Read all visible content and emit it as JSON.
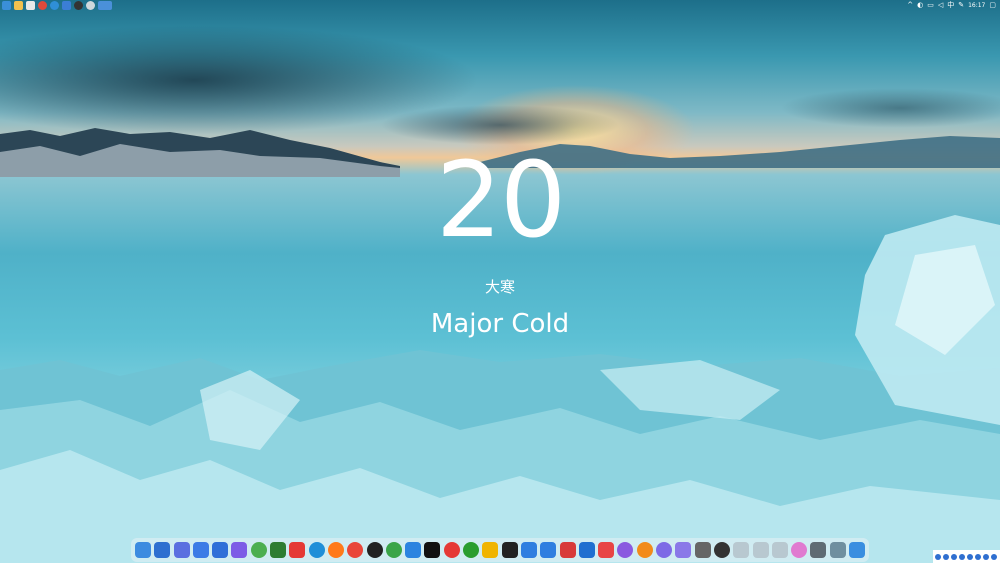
{
  "wallpaper": {
    "day_number": "20",
    "solar_term_cn": "大寒",
    "solar_term_en": "Major Cold"
  },
  "topbar": {
    "left_icons": [
      {
        "name": "windows-start-icon",
        "color": "#3a8fd8"
      },
      {
        "name": "folder-icon",
        "color": "#f2c14e"
      },
      {
        "name": "file-icon",
        "color": "#e8e8e8"
      },
      {
        "name": "chrome-icon",
        "color": "#e04a3a"
      },
      {
        "name": "edge-icon",
        "color": "#2f8fd6"
      },
      {
        "name": "mail-icon",
        "color": "#3b7ed6"
      },
      {
        "name": "camera-icon",
        "color": "#333333"
      },
      {
        "name": "gear-icon",
        "color": "#cfd8dc"
      },
      {
        "name": "window-icon",
        "color": "#4a90d9"
      }
    ],
    "clock_time": "16:17"
  },
  "dock": {
    "icons": [
      {
        "name": "finder-icon",
        "color": "#3d8be0"
      },
      {
        "name": "desktop-icon",
        "color": "#2d6fd0"
      },
      {
        "name": "launchpad-icon",
        "color": "#5b6fe0"
      },
      {
        "name": "grid-apps-icon",
        "color": "#3c7be6"
      },
      {
        "name": "xcode-icon",
        "color": "#2f6fd8"
      },
      {
        "name": "discord-icon",
        "color": "#7d5ce6"
      },
      {
        "name": "wechat-work-icon",
        "color": "#4caf50"
      },
      {
        "name": "evernote-icon",
        "color": "#2e7d32"
      },
      {
        "name": "vivaldi-icon",
        "color": "#e53935"
      },
      {
        "name": "edge-icon",
        "color": "#1f8fd8"
      },
      {
        "name": "firefox-icon",
        "color": "#ff7a1a"
      },
      {
        "name": "chrome-icon",
        "color": "#e9463a"
      },
      {
        "name": "qq-icon",
        "color": "#222222"
      },
      {
        "name": "wechat-icon",
        "color": "#3aa548"
      },
      {
        "name": "bird-icon",
        "color": "#2b84e0"
      },
      {
        "name": "tiktok-icon",
        "color": "#111111"
      },
      {
        "name": "netease-music-icon",
        "color": "#e53935"
      },
      {
        "name": "kugou-icon",
        "color": "#2a9d2f"
      },
      {
        "name": "ai-icon",
        "color": "#f0b400"
      },
      {
        "name": "arrow-app-icon",
        "color": "#222222"
      },
      {
        "name": "pen-icon",
        "color": "#2f7ee0"
      },
      {
        "name": "list-icon",
        "color": "#2f7ee0"
      },
      {
        "name": "calendar-icon",
        "color": "#d83a3a"
      },
      {
        "name": "search-icon",
        "color": "#1f6fd0"
      },
      {
        "name": "screenshot-icon",
        "color": "#e84545"
      },
      {
        "name": "color-wheel-icon",
        "color": "#8a5ae0"
      },
      {
        "name": "orange-app-icon",
        "color": "#f28b1a"
      },
      {
        "name": "purple-app-icon",
        "color": "#7d6ae6"
      },
      {
        "name": "volume-icon",
        "color": "#8a78e8"
      },
      {
        "name": "gallery-icon",
        "color": "#666666"
      },
      {
        "name": "power-icon",
        "color": "#333333"
      },
      {
        "name": "more-icon",
        "color": "#b8c8d0"
      },
      {
        "name": "chevron-icon",
        "color": "#b8c8d0"
      },
      {
        "name": "chevron-down-icon",
        "color": "#b8c8d0"
      },
      {
        "name": "pinwheel-icon",
        "color": "#e07ad0"
      },
      {
        "name": "settings-icon",
        "color": "#5f6b73"
      },
      {
        "name": "photos-icon",
        "color": "#6f8f9f"
      },
      {
        "name": "store-icon",
        "color": "#3a8ee0"
      }
    ]
  },
  "tray": {
    "icons": [
      {
        "name": "ime-icon",
        "color": "#2f6fd0"
      },
      {
        "name": "language-icon",
        "color": "#2f6fd0"
      },
      {
        "name": "moon-icon",
        "color": "#2f6fd0"
      },
      {
        "name": "punctuation-icon",
        "color": "#2f6fd0"
      },
      {
        "name": "emoji-icon",
        "color": "#2f6fd0"
      },
      {
        "name": "keyboard-icon",
        "color": "#2f6fd0"
      },
      {
        "name": "skin-icon",
        "color": "#2f6fd0"
      },
      {
        "name": "menu-icon",
        "color": "#2f6fd0"
      }
    ]
  }
}
